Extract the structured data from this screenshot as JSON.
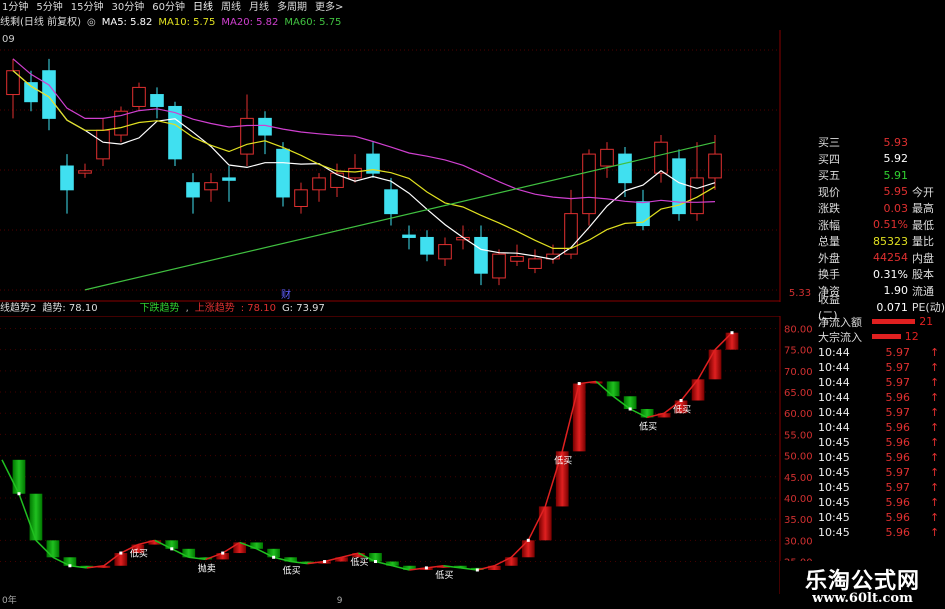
{
  "tabs": [
    "1分钟",
    "5分钟",
    "15分钟",
    "30分钟",
    "60分钟",
    "日线",
    "周线",
    "月线",
    "多周期",
    "更多>"
  ],
  "active_tab": 5,
  "ma_row": {
    "title": "线剩(日线 前复权)",
    "ma5": {
      "label": "MA5: 5.82",
      "color": "#ffffff"
    },
    "ma10": {
      "label": "MA10: 5.75",
      "color": "#e0e020"
    },
    "ma20": {
      "label": "MA20: 5.82",
      "color": "#d040d0"
    },
    "ma60": {
      "label": "MA60: 5.75",
      "color": "#40c040"
    }
  },
  "main_chart": {
    "price_label_right": "5.33",
    "top_left_value": "09",
    "marker_label": "财",
    "candles": [
      {
        "o": 6.05,
        "c": 6.15,
        "h": 6.2,
        "l": 5.95
      },
      {
        "o": 6.1,
        "c": 6.02,
        "h": 6.15,
        "l": 5.98
      },
      {
        "o": 6.15,
        "c": 5.95,
        "h": 6.2,
        "l": 5.9
      },
      {
        "o": 5.75,
        "c": 5.65,
        "h": 5.8,
        "l": 5.55
      },
      {
        "o": 5.72,
        "c": 5.73,
        "h": 5.76,
        "l": 5.7
      },
      {
        "o": 5.78,
        "c": 5.9,
        "h": 5.95,
        "l": 5.75
      },
      {
        "o": 5.88,
        "c": 5.98,
        "h": 6.0,
        "l": 5.85
      },
      {
        "o": 6.0,
        "c": 6.08,
        "h": 6.1,
        "l": 5.98
      },
      {
        "o": 6.05,
        "c": 6.0,
        "h": 6.08,
        "l": 5.95
      },
      {
        "o": 6.0,
        "c": 5.78,
        "h": 6.02,
        "l": 5.75
      },
      {
        "o": 5.68,
        "c": 5.62,
        "h": 5.72,
        "l": 5.55
      },
      {
        "o": 5.65,
        "c": 5.68,
        "h": 5.72,
        "l": 5.6
      },
      {
        "o": 5.7,
        "c": 5.69,
        "h": 5.75,
        "l": 5.6
      },
      {
        "o": 5.8,
        "c": 5.95,
        "h": 6.05,
        "l": 5.75
      },
      {
        "o": 5.95,
        "c": 5.88,
        "h": 5.98,
        "l": 5.8
      },
      {
        "o": 5.82,
        "c": 5.62,
        "h": 5.85,
        "l": 5.58
      },
      {
        "o": 5.58,
        "c": 5.65,
        "h": 5.68,
        "l": 5.55
      },
      {
        "o": 5.65,
        "c": 5.7,
        "h": 5.72,
        "l": 5.6
      },
      {
        "o": 5.66,
        "c": 5.72,
        "h": 5.76,
        "l": 5.62
      },
      {
        "o": 5.7,
        "c": 5.74,
        "h": 5.8,
        "l": 5.68
      },
      {
        "o": 5.8,
        "c": 5.72,
        "h": 5.85,
        "l": 5.7
      },
      {
        "o": 5.65,
        "c": 5.55,
        "h": 5.7,
        "l": 5.5
      },
      {
        "o": 5.46,
        "c": 5.45,
        "h": 5.5,
        "l": 5.4
      },
      {
        "o": 5.45,
        "c": 5.38,
        "h": 5.48,
        "l": 5.35
      },
      {
        "o": 5.36,
        "c": 5.42,
        "h": 5.45,
        "l": 5.33
      },
      {
        "o": 5.44,
        "c": 5.45,
        "h": 5.5,
        "l": 5.4
      },
      {
        "o": 5.45,
        "c": 5.3,
        "h": 5.5,
        "l": 5.25
      },
      {
        "o": 5.28,
        "c": 5.38,
        "h": 5.4,
        "l": 5.25
      },
      {
        "o": 5.35,
        "c": 5.37,
        "h": 5.42,
        "l": 5.33
      },
      {
        "o": 5.32,
        "c": 5.36,
        "h": 5.4,
        "l": 5.3
      },
      {
        "o": 5.36,
        "c": 5.38,
        "h": 5.42,
        "l": 5.34
      },
      {
        "o": 5.38,
        "c": 5.55,
        "h": 5.65,
        "l": 5.36
      },
      {
        "o": 5.55,
        "c": 5.8,
        "h": 5.82,
        "l": 5.5
      },
      {
        "o": 5.75,
        "c": 5.82,
        "h": 5.85,
        "l": 5.7
      },
      {
        "o": 5.8,
        "c": 5.68,
        "h": 5.83,
        "l": 5.62
      },
      {
        "o": 5.6,
        "c": 5.5,
        "h": 5.65,
        "l": 5.48
      },
      {
        "o": 5.72,
        "c": 5.85,
        "h": 5.88,
        "l": 5.68
      },
      {
        "o": 5.78,
        "c": 5.55,
        "h": 5.82,
        "l": 5.52
      },
      {
        "o": 5.55,
        "c": 5.7,
        "h": 5.85,
        "l": 5.52
      },
      {
        "o": 5.7,
        "c": 5.8,
        "h": 5.88,
        "l": 5.65
      }
    ],
    "ylim": [
      5.2,
      6.3
    ]
  },
  "ind_row": {
    "title": "线趋势2",
    "trend": "趋势: 78.10",
    "down_label": "下跌趋势",
    "up_label": "上涨趋势",
    "up_value": ": 78.10",
    "g_label": "G: 73.97"
  },
  "indicator": {
    "axis_labels": [
      "80.00",
      "75.00",
      "70.00",
      "65.00",
      "60.00",
      "55.00",
      "50.00",
      "45.00",
      "40.00",
      "35.00",
      "30.00",
      "25.00"
    ],
    "ylim": [
      23,
      82
    ],
    "values": [
      49,
      41,
      30,
      26,
      24,
      23.5,
      24,
      27,
      29,
      30,
      28,
      26,
      25.5,
      27,
      29.5,
      28,
      26,
      25,
      24.5,
      25,
      26,
      27,
      25,
      24,
      23,
      23.5,
      24,
      23.5,
      23,
      24,
      26,
      30,
      38,
      51,
      67,
      67.5,
      64,
      61,
      59,
      60,
      63,
      68,
      75,
      79
    ],
    "labels": [
      {
        "i": 8,
        "text": "低买"
      },
      {
        "i": 12,
        "text": "抛卖"
      },
      {
        "i": 17,
        "text": "低买"
      },
      {
        "i": 21,
        "text": "低买"
      },
      {
        "i": 26,
        "text": "低买"
      },
      {
        "i": 38,
        "text": "低买"
      },
      {
        "i": 33,
        "text": "低买"
      },
      {
        "i": 40,
        "text": "低买"
      }
    ]
  },
  "quotes": [
    {
      "k": "买三",
      "v": "5.93",
      "vc": "#e03030",
      "k2": ""
    },
    {
      "k": "买四",
      "v": "5.92",
      "vc": "#ffffff",
      "k2": ""
    },
    {
      "k": "买五",
      "v": "5.91",
      "vc": "#30d030",
      "k2": ""
    },
    {
      "k": "现价",
      "v": "5.95",
      "vc": "#e03030",
      "k2": "今开"
    },
    {
      "k": "涨跌",
      "v": "0.03",
      "vc": "#e03030",
      "k2": "最高"
    },
    {
      "k": "涨幅",
      "v": "0.51%",
      "vc": "#e03030",
      "k2": "最低"
    },
    {
      "k": "总量",
      "v": "85323",
      "vc": "#e0e020",
      "k2": "量比"
    },
    {
      "k": "外盘",
      "v": "44254",
      "vc": "#e03030",
      "k2": "内盘"
    },
    {
      "k": "换手",
      "v": "0.31%",
      "vc": "#ffffff",
      "k2": "股本"
    },
    {
      "k": "净资",
      "v": "1.90",
      "vc": "#ffffff",
      "k2": "流通"
    },
    {
      "k": "收益(二)",
      "v": "0.071",
      "vc": "#ffffff",
      "k2": "PE(动)"
    }
  ],
  "flow": [
    {
      "k": "净流入额",
      "bar": 72,
      "num": "21"
    },
    {
      "k": "大宗流入",
      "bar": 48,
      "num": "12"
    }
  ],
  "ticks": [
    {
      "t": "10:44",
      "p": "5.97"
    },
    {
      "t": "10:44",
      "p": "5.97"
    },
    {
      "t": "10:44",
      "p": "5.97"
    },
    {
      "t": "10:44",
      "p": "5.96"
    },
    {
      "t": "10:44",
      "p": "5.97"
    },
    {
      "t": "10:44",
      "p": "5.96"
    },
    {
      "t": "10:45",
      "p": "5.96"
    },
    {
      "t": "10:45",
      "p": "5.96"
    },
    {
      "t": "10:45",
      "p": "5.97"
    },
    {
      "t": "10:45",
      "p": "5.97"
    },
    {
      "t": "10:45",
      "p": "5.96"
    },
    {
      "t": "10:45",
      "p": "5.96"
    },
    {
      "t": "10:45",
      "p": "5.96"
    }
  ],
  "watermark": {
    "line1": "乐淘公式网",
    "line2": "www.60lt.com"
  },
  "bottom_bar": [
    "0年",
    "9"
  ]
}
